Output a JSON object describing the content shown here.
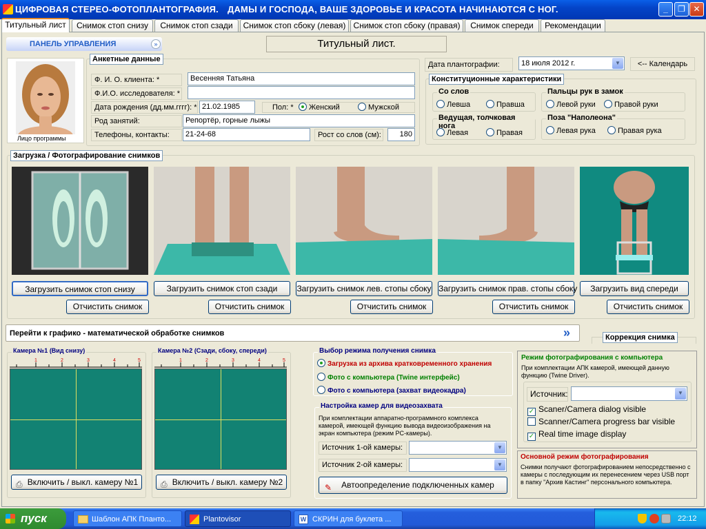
{
  "window": {
    "title": "ЦИФРОВАЯ СТЕРЕО-ФОТОПЛАНТОГРАФИЯ.",
    "slogan": "ДАМЫ И ГОСПОДА, ВАШЕ ЗДОРОВЬЕ И КРАСОТА НАЧИНАЮТСЯ С НОГ.",
    "min": "_",
    "max": "❐",
    "close": "✕"
  },
  "tabs": [
    "Титульный лист",
    "Снимок стоп снизу",
    "Снимок стоп сзади",
    "Снимок стоп сбоку (левая)",
    "Снимок стоп сбоку (правая)",
    "Снимок спереди",
    "Рекомендации"
  ],
  "control_panel": {
    "label": "ПАНЕЛЬ УПРАВЛЕНИЯ",
    "icon": "double-chevron-down-icon"
  },
  "page_title": "Титульный лист.",
  "avatar_caption": "Лицо программы",
  "personal": {
    "legend": "Анкетные данные",
    "client_label": "Ф. И. О. клиента: *",
    "client_value": "Весенняя Татьяна",
    "researcher_label": "Ф.И.О. исследователя: *",
    "researcher_value": "",
    "dob_label": "Дата рождения (дд.мм.гггг): *",
    "dob_value": "21.02.1985",
    "sex_label": "Пол: *",
    "sex_female": "Женский",
    "sex_male": "Мужской",
    "occupation_label": "Род занятий:",
    "occupation_value": "Репортёр, горные лыжы",
    "phone_label": "Телефоны, контакты:",
    "phone_value": "21-24-68",
    "height_label": "Рост со слов (см):",
    "height_value": "180"
  },
  "date": {
    "label": "Дата плантографии:",
    "value": "18    июля    2012 г.",
    "calendar_btn": "<-- Календарь"
  },
  "constitution": {
    "legend": "Конституционные характеристики",
    "g1": "Со слов",
    "g1a": "Левша",
    "g1b": "Правша",
    "g2": "Пальцы рук в замок",
    "g2a": "Левой руки",
    "g2b": "Правой руки",
    "g3": "Ведущая, толчковая нога",
    "g3a": "Левая",
    "g3b": "Правая",
    "g4": "Поза \"Наполеона\"",
    "g4a": "Левая рука",
    "g4b": "Правая рука"
  },
  "upload": {
    "legend": "Загрузка / Фотографирование снимков",
    "load": [
      "Загрузить снимок стоп снизу",
      "Загрузить снимок стоп сзади",
      "Загрузить снимок лев. стопы сбоку",
      "Загрузить снимок прав. стопы сбоку",
      "Загрузить вид спереди"
    ],
    "clear": "Отчистить снимок"
  },
  "goto_processing": {
    "label": "Перейти к графико - математической обработке снимков",
    "icon": "double-chevron-right-icon"
  },
  "correction": "Коррекция снимка",
  "cam1": {
    "legend": "Камера №1 (Вид снизу)",
    "btn": "Включить / выкл. камеру №1"
  },
  "cam2": {
    "legend": "Камера №2 (Сзади, сбоку, спереди)",
    "btn": "Включить / выкл. камеру №2"
  },
  "ruler_ticks": [
    "1",
    "2",
    "3",
    "4",
    "5"
  ],
  "mode": {
    "legend": "Выбор режима получения снимка",
    "opt1": "Загрузка из архива кратковременного хранения",
    "opt2": "Фото с компьютера (Twine интерфейс)",
    "opt3": "Фото с компьютера (захват видеокадра)",
    "colors": {
      "opt1": "#C00000",
      "opt2": "#008000",
      "opt3": "#000080"
    }
  },
  "video": {
    "legend": "Настройка камер для видеозахвата",
    "desc": "При комплектации аппаратно-программного комплекса камерой, имеющей функцию вывода видеоизображения на экран компьютера (режим PC-камеры).",
    "src1": "Источник 1-ой камеры:",
    "src2": "Источник 2-ой камеры:",
    "auto_btn": "Автоопределение подключенных камер"
  },
  "pcmode": {
    "legend": "Режим фотографирования с компьютера",
    "desc": "При комплектации АПК камерой, имеющей данную функцию (Twine Driver).",
    "source": "Источник:",
    "chk1": "Scaner/Camera dialog visible",
    "chk2": "Scanner/Camera progress bar visible",
    "chk3": "Real time image display"
  },
  "mainmode": {
    "legend": "Основной режим фотографирования",
    "desc": "Снимки получают фотографированием непосредственно с камеры с последующим их перенесением через USB порт в папку \"Архив Кастинг\" персонального компьютера."
  },
  "taskbar": {
    "start": "пуск",
    "items": [
      "Шаблон АПК Планто...",
      "Plantovisor",
      "СКРИН для буклета ..."
    ],
    "lang": "RU",
    "clock": "22:12"
  }
}
